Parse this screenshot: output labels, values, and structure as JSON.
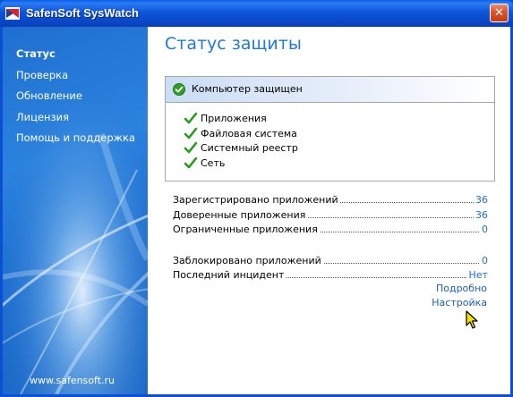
{
  "window": {
    "title": "SafenSoft SysWatch",
    "close_symbol": "✕"
  },
  "sidebar": {
    "items": [
      {
        "label": "Статус",
        "active": true
      },
      {
        "label": "Проверка"
      },
      {
        "label": "Обновление"
      },
      {
        "label": "Лицензия"
      },
      {
        "label": "Помощь и поддержка"
      }
    ],
    "site": "www.safensoft.ru"
  },
  "main": {
    "title": "Статус защиты",
    "status": {
      "title": "Компьютер защищен",
      "icon": "check-circle-icon",
      "checks": [
        "Приложения",
        "Файловая система",
        "Системный реестр",
        "Сеть"
      ]
    },
    "stats_group1": [
      {
        "label": "Зарегистрировано приложений",
        "value": "36"
      },
      {
        "label": "Доверенные приложения",
        "value": "36"
      },
      {
        "label": "Ограниченные приложения",
        "value": "0"
      }
    ],
    "stats_group2": [
      {
        "label": "Заблокировано приложений",
        "value": "0"
      },
      {
        "label": "Последний инцидент",
        "value": "Нет"
      }
    ],
    "links": {
      "details": "Подробно",
      "settings": "Настройка"
    }
  },
  "colors": {
    "accent": "#1e7ad8",
    "titlebar": "#0a4fd4",
    "sidebar": "#2b83de",
    "check": "#2a9a1e"
  }
}
